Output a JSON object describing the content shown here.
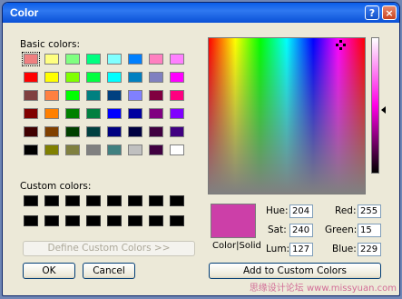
{
  "window": {
    "title": "Color",
    "help": "?",
    "close": "×"
  },
  "labels": {
    "basic": "Basic colors:",
    "custom": "Custom colors:",
    "color_solid": "Color|Solid"
  },
  "basic_colors": [
    [
      "#f08080",
      "#ffff80",
      "#80ff80",
      "#00ff80",
      "#80ffff",
      "#0080ff",
      "#ff80c0",
      "#ff80ff"
    ],
    [
      "#ff0000",
      "#ffff00",
      "#80ff00",
      "#00ff40",
      "#00ffff",
      "#0080c0",
      "#8080c0",
      "#ff00ff"
    ],
    [
      "#804040",
      "#ff8040",
      "#00ff00",
      "#008080",
      "#004080",
      "#8080ff",
      "#800040",
      "#ff0080"
    ],
    [
      "#800000",
      "#ff8000",
      "#008000",
      "#008040",
      "#0000ff",
      "#0000a0",
      "#800080",
      "#8000ff"
    ],
    [
      "#400000",
      "#804000",
      "#004000",
      "#004040",
      "#000080",
      "#000040",
      "#400040",
      "#400080"
    ],
    [
      "#000000",
      "#808000",
      "#808040",
      "#808080",
      "#408080",
      "#c0c0c0",
      "#400040",
      "#ffffff"
    ]
  ],
  "custom_colors": [
    [
      "#000000",
      "#000000",
      "#000000",
      "#000000",
      "#000000",
      "#000000",
      "#000000",
      "#000000"
    ],
    [
      "#000000",
      "#000000",
      "#000000",
      "#000000",
      "#000000",
      "#000000",
      "#000000",
      "#000000"
    ]
  ],
  "buttons": {
    "define_custom": "Define Custom Colors >>",
    "ok": "OK",
    "cancel": "Cancel",
    "add_custom": "Add to Custom Colors"
  },
  "hsl": {
    "hue_label": "Hue:",
    "hue": "204",
    "sat_label": "Sat:",
    "sat": "240",
    "lum_label": "Lum:",
    "lum": "127"
  },
  "rgb": {
    "red_label": "Red:",
    "red": "255",
    "green_label": "Green:",
    "green": "15",
    "blue_label": "Blue:",
    "blue": "229"
  },
  "preview_color": "#cc3fa8",
  "watermark": "思缘设计论坛 www.missyuan.com"
}
